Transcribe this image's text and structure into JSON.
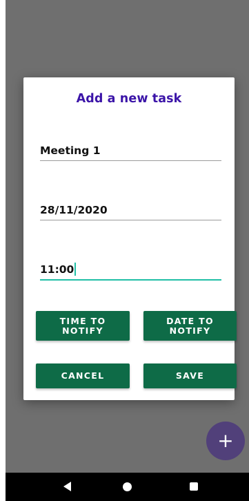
{
  "dialog": {
    "title": "Add a new task",
    "task_name": "Meeting 1",
    "task_date": "28/11/2020",
    "task_time": "11:00"
  },
  "buttons": {
    "time_to_notify": "TIME TO\nNOTIFY",
    "date_to_notify": "DATE TO\nNOTIFY",
    "cancel": "CANCEL",
    "save": "SAVE"
  },
  "fab": {
    "label": "+",
    "color": "#51407a"
  },
  "colors": {
    "title": "#3b14a8",
    "button": "#0e6b47",
    "focus_underline": "#1fbfa6"
  }
}
